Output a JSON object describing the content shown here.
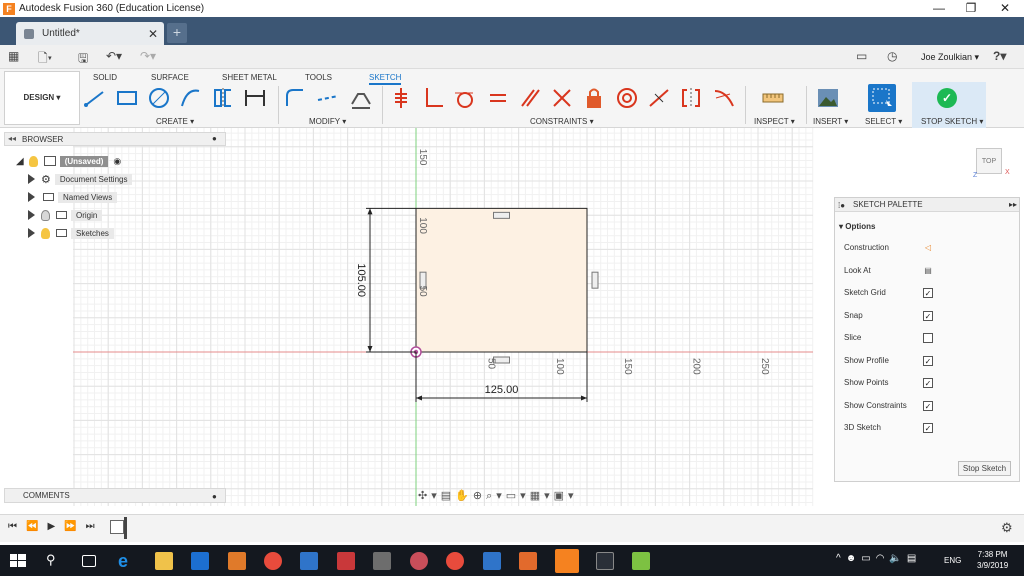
{
  "window": {
    "title": "Autodesk Fusion 360 (Education License)",
    "logo": "F",
    "min_icon": "minimize-icon",
    "max_icon": "maximize-icon",
    "close_icon": "close-icon"
  },
  "tabs": {
    "document": "Untitled*",
    "new_tab": "+"
  },
  "quick_access": {
    "user": "Joe Zoulkian",
    "help": "?"
  },
  "ribbon": {
    "workspace": "DESIGN",
    "tabs": [
      "SOLID",
      "SURFACE",
      "SHEET METAL",
      "TOOLS",
      "SKETCH"
    ],
    "active_tab": "SKETCH",
    "groups": [
      "CREATE",
      "MODIFY",
      "CONSTRAINTS",
      "INSPECT",
      "INSERT",
      "SELECT",
      "STOP SKETCH"
    ]
  },
  "browser": {
    "title": "BROWSER",
    "root": "(Unsaved)",
    "items": [
      "Document Settings",
      "Named Views",
      "Origin",
      "Sketches"
    ]
  },
  "comments": {
    "title": "COMMENTS"
  },
  "viewcube": {
    "label": "TOP",
    "z": "Z",
    "x": "X"
  },
  "sketch": {
    "dim_height": "105.00",
    "dim_width": "125.00",
    "ticks_x": [
      "50",
      "100",
      "150",
      "200",
      "250"
    ],
    "ticks_y": [
      "150",
      "100",
      "50"
    ]
  },
  "palette": {
    "title": "SKETCH PALETTE",
    "section": "Options",
    "rows": [
      {
        "label": "Construction",
        "type": "icon"
      },
      {
        "label": "Look At",
        "type": "icon"
      },
      {
        "label": "Sketch Grid",
        "type": "check",
        "checked": true
      },
      {
        "label": "Snap",
        "type": "check",
        "checked": true
      },
      {
        "label": "Slice",
        "type": "check",
        "checked": false
      },
      {
        "label": "Show Profile",
        "type": "check",
        "checked": true
      },
      {
        "label": "Show Points",
        "type": "check",
        "checked": true
      },
      {
        "label": "Show Constraints",
        "type": "check",
        "checked": true
      },
      {
        "label": "3D Sketch",
        "type": "check",
        "checked": true
      }
    ],
    "stop_button": "Stop Sketch"
  },
  "taskbar": {
    "lang": "ENG",
    "time": "7:38 PM",
    "date": "3/9/2019"
  },
  "colors": {
    "titlebar_tab": "#3c5674",
    "accent": "#1a76c9",
    "sketch_fill": "#fdf1e3",
    "axis_red": "#e58b8b",
    "axis_green": "#7ed27e"
  }
}
